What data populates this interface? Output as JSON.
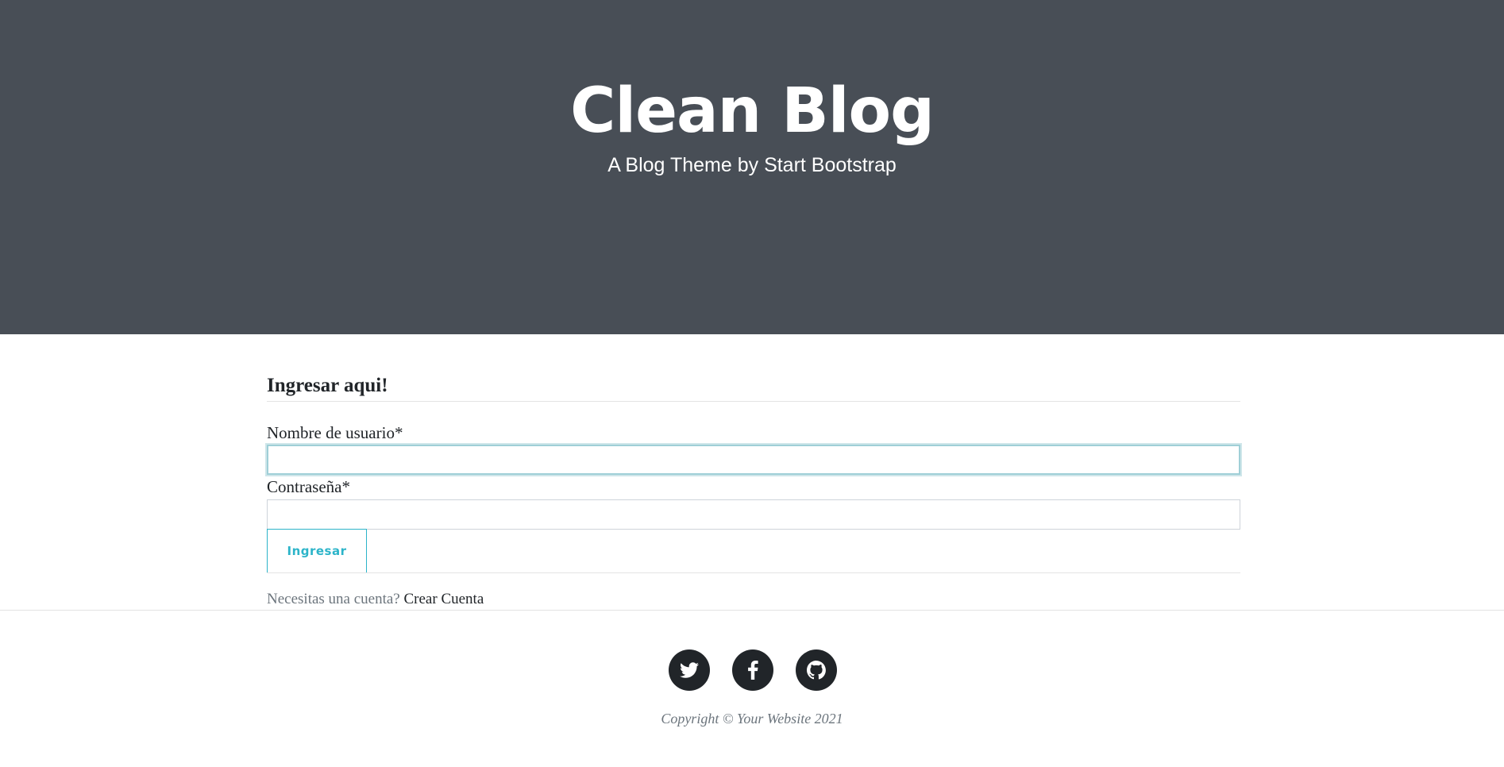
{
  "header": {
    "title": "Clean Blog",
    "subtitle": "A Blog Theme by Start Bootstrap"
  },
  "login_form": {
    "heading": "Ingresar aqui!",
    "username_label": "Nombre de usuario*",
    "username_value": "",
    "password_label": "Contraseña*",
    "password_value": "",
    "submit_label": "Ingresar",
    "account_prompt": "Necesitas una cuenta?",
    "create_account_link": "Crear Cuenta"
  },
  "footer": {
    "social_icons": [
      "twitter-icon",
      "facebook-icon",
      "github-icon"
    ],
    "copyright": "Copyright © Your Website 2021"
  },
  "colors": {
    "header_bg": "#484e56",
    "accent": "#2cb4c9",
    "focus_border": "#9fcfd7",
    "social_bg": "#212529"
  }
}
